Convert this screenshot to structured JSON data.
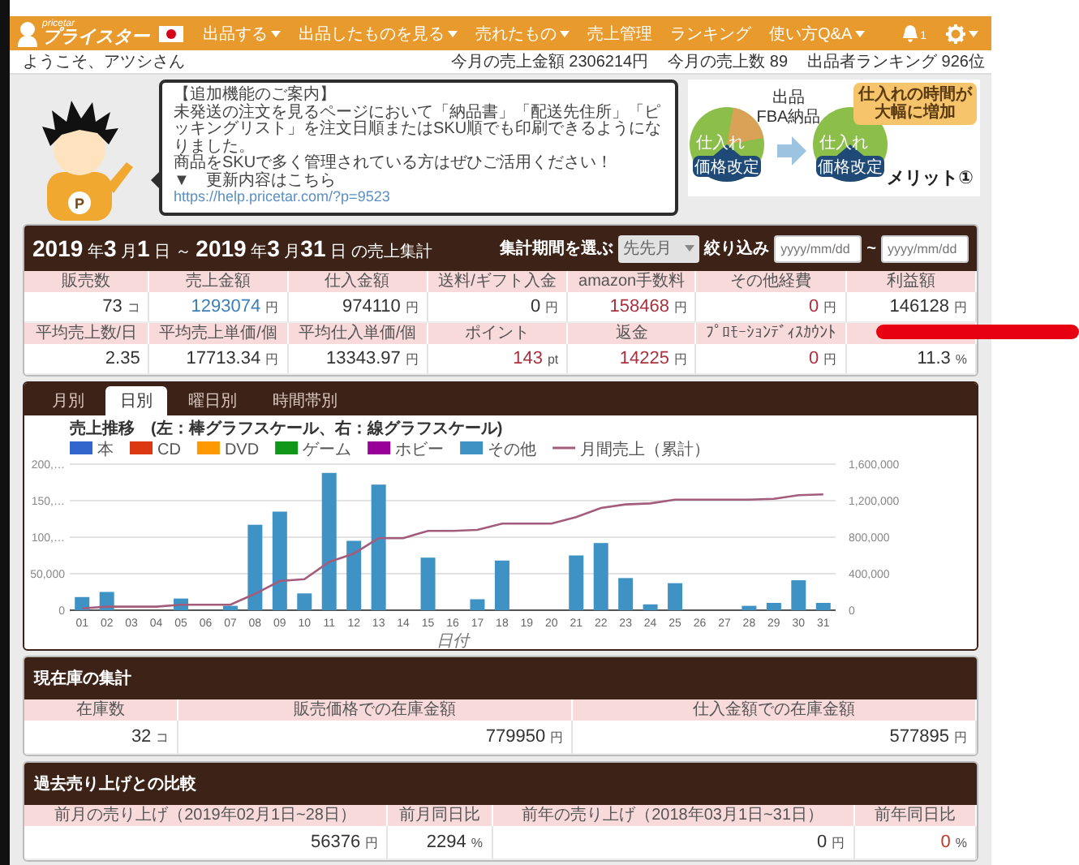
{
  "header": {
    "logo_caption": "pricetar",
    "logo": "プライスター",
    "nav": [
      {
        "label": "出品する",
        "dropdown": true
      },
      {
        "label": "出品したものを見る",
        "dropdown": true
      },
      {
        "label": "売れたもの",
        "dropdown": true
      },
      {
        "label": "売上管理",
        "dropdown": false
      },
      {
        "label": "ランキング",
        "dropdown": false
      },
      {
        "label": "使い方Q&A",
        "dropdown": true
      }
    ],
    "notification_count": "1"
  },
  "welcome": {
    "greeting": "ようこそ、アツシさん",
    "stats": [
      "今月の売上金額 2306214円",
      "今月の売上数 89",
      "出品者ランキング 926位"
    ]
  },
  "mascot": {
    "badge": "P"
  },
  "notice": {
    "title": "【追加機能のご案内】",
    "paragraphs": [
      "未発送の注文を見るページにおいて「納品書」「配送先住所」「ピッキングリスト」を注文日順またはSKU順でも印刷できるようになりました。",
      "商品をSKUで多く管理されている方はぜひご活用ください！"
    ],
    "link_label": "▼　更新内容はこちら",
    "url": "https://help.pricetar.com/?p=9523"
  },
  "promo": {
    "pies": [
      {
        "top": "仕入れ",
        "bottom": "価格改定"
      },
      {
        "top": "仕入れ",
        "bottom": "価格改定"
      }
    ],
    "step": [
      "出品",
      "FBA納品"
    ],
    "callout": "仕入れの時間が大幅に増加",
    "merit": "メリット①"
  },
  "summary": {
    "title": "**2019** 年**3** 月**1** 日 ～ **2019** 年**3** 月**31** 日 の売上集計",
    "period_label": "集計期間を選ぶ",
    "period": "先先月",
    "filter_label": "絞り込み",
    "from_placeholder": "yyyy/mm/dd",
    "separator": "~",
    "to_placeholder": "yyyy/mm/dd",
    "rows": [
      [
        {
          "label": "販売数",
          "value": "73",
          "unit": "コ"
        },
        {
          "label": "売上金額",
          "value": "1293074",
          "unit": "円",
          "color": "#3d7fb8"
        },
        {
          "label": "仕入金額",
          "value": "974110",
          "unit": "円"
        },
        {
          "label": "送料/ギフト入金",
          "value": "0",
          "unit": "円"
        },
        {
          "label": "amazon手数料",
          "value": "158468",
          "unit": "円",
          "color": "#a8323e"
        },
        {
          "label": "その他経費",
          "value": "0",
          "unit": "円",
          "color": "#a8323e"
        },
        {
          "label": "利益額",
          "value": "146128",
          "unit": "円"
        }
      ],
      [
        {
          "label": "平均売上数/日",
          "value": "2.35"
        },
        {
          "label": "平均売上単価/個",
          "value": "17713.34",
          "unit": "円"
        },
        {
          "label": "平均仕入単価/個",
          "value": "13343.97",
          "unit": "円"
        },
        {
          "label": "ポイント",
          "value": "143",
          "unit": "pt",
          "color": "#a8323e"
        },
        {
          "label": "返金",
          "value": "14225",
          "unit": "円",
          "color": "#a8323e"
        },
        {
          "label": "ﾌﾟﾛﾓｰｼｮﾝﾃﾞｨｽｶｳﾝﾄ",
          "value": "0",
          "unit": "円",
          "color": "#a8323e"
        },
        {
          "value": "11.3",
          "unit": "%"
        }
      ]
    ]
  },
  "chart": {
    "tabs": [
      {
        "label": "月別",
        "selected": false
      },
      {
        "label": "日別",
        "selected": true
      },
      {
        "label": "曜日別",
        "selected": false
      },
      {
        "label": "時間帯別",
        "selected": false
      }
    ],
    "chart_data": {
      "type": "bar",
      "title": "売上推移　(左：棒グラフスケール、右：線グラフスケール)",
      "xlabel": "日付",
      "stacked": true,
      "grid": true,
      "legend": true,
      "categories": [
        "01",
        "02",
        "03",
        "04",
        "05",
        "06",
        "07",
        "08",
        "09",
        "10",
        "11",
        "12",
        "13",
        "14",
        "15",
        "16",
        "17",
        "18",
        "19",
        "20",
        "21",
        "22",
        "23",
        "24",
        "25",
        "26",
        "27",
        "28",
        "29",
        "30",
        "31"
      ],
      "series": [
        {
          "name": "本",
          "color": "#3366cc",
          "values": [
            0,
            0,
            0,
            0,
            0,
            0,
            0,
            0,
            0,
            0,
            0,
            0,
            0,
            0,
            0,
            0,
            0,
            0,
            0,
            0,
            0,
            0,
            0,
            0,
            0,
            0,
            0,
            0,
            0,
            0,
            0
          ]
        },
        {
          "name": "CD",
          "color": "#dc3912",
          "values": [
            0,
            0,
            0,
            0,
            0,
            0,
            0,
            0,
            0,
            0,
            0,
            0,
            0,
            0,
            0,
            0,
            0,
            0,
            0,
            0,
            0,
            0,
            0,
            0,
            0,
            0,
            0,
            0,
            0,
            0,
            0
          ]
        },
        {
          "name": "DVD",
          "color": "#ff9900",
          "values": [
            0,
            0,
            0,
            0,
            0,
            0,
            0,
            0,
            0,
            0,
            0,
            0,
            0,
            0,
            0,
            0,
            0,
            0,
            0,
            0,
            0,
            0,
            0,
            0,
            0,
            0,
            0,
            0,
            0,
            0,
            0
          ]
        },
        {
          "name": "ゲーム",
          "color": "#109618",
          "values": [
            0,
            0,
            0,
            0,
            0,
            0,
            0,
            0,
            0,
            0,
            0,
            0,
            0,
            0,
            0,
            0,
            0,
            0,
            0,
            0,
            0,
            0,
            0,
            0,
            0,
            0,
            0,
            0,
            0,
            0,
            0
          ]
        },
        {
          "name": "ホビー",
          "color": "#990099",
          "values": [
            0,
            0,
            0,
            0,
            0,
            0,
            0,
            0,
            0,
            0,
            0,
            0,
            0,
            0,
            0,
            0,
            0,
            0,
            0,
            0,
            0,
            0,
            0,
            0,
            0,
            0,
            0,
            0,
            0,
            0,
            0
          ]
        },
        {
          "name": "その他",
          "color": "#3e92c4",
          "values": [
            18000,
            25000,
            0,
            0,
            16000,
            0,
            6000,
            117000,
            135000,
            23000,
            188000,
            95000,
            172000,
            0,
            72000,
            0,
            15000,
            68000,
            0,
            0,
            75000,
            92000,
            44000,
            8000,
            37000,
            0,
            0,
            6000,
            10000,
            41000,
            10000
          ]
        },
        {
          "name": "月間売上（累計）",
          "color": "#a35c7c",
          "type": "line",
          "axis": "y2",
          "values": [
            20000,
            40000,
            40000,
            40000,
            60000,
            60000,
            60000,
            180000,
            320000,
            340000,
            530000,
            620000,
            790000,
            790000,
            870000,
            870000,
            880000,
            950000,
            950000,
            950000,
            1020000,
            1120000,
            1160000,
            1170000,
            1210000,
            1210000,
            1210000,
            1210000,
            1220000,
            1260000,
            1270000
          ]
        }
      ],
      "ylim": [
        0,
        200000
      ],
      "yticks": [
        {
          "value": 0,
          "label": "0"
        },
        {
          "value": 50000,
          "label": "50,000"
        },
        {
          "value": 100000,
          "label": "100,…"
        },
        {
          "value": 150000,
          "label": "150,…"
        },
        {
          "value": 200000,
          "label": "200,…"
        }
      ],
      "y2lim": [
        0,
        1600000
      ],
      "y2ticks": [
        {
          "value": 0,
          "label": "0"
        },
        {
          "value": 400000,
          "label": "400,000"
        },
        {
          "value": 800000,
          "label": "800,000"
        },
        {
          "value": 1200000,
          "label": "1,200,000"
        },
        {
          "value": 1600000,
          "label": "1,600,000"
        }
      ]
    }
  },
  "stock": {
    "title": "現在庫の集計",
    "cells": [
      {
        "label": "在庫数",
        "value": "32",
        "unit": "コ"
      },
      {
        "label": "販売価格での在庫金額",
        "value": "779950",
        "unit": "円"
      },
      {
        "label": "仕入金額での在庫金額",
        "value": "577895",
        "unit": "円"
      }
    ]
  },
  "comparison": {
    "title": "過去売り上げとの比較",
    "cells": [
      {
        "label": "前月の売り上げ（2019年02月1日~28日）",
        "value": "56376",
        "unit": "円"
      },
      {
        "label": "前月同日比",
        "value": "2294",
        "unit": "%"
      },
      {
        "label": "前年の売り上げ（2018年03月1日~31日）",
        "value": "0",
        "unit": "円"
      },
      {
        "label": "前年同日比",
        "value": "0",
        "unit": "%",
        "color": "#c0392b"
      }
    ]
  }
}
